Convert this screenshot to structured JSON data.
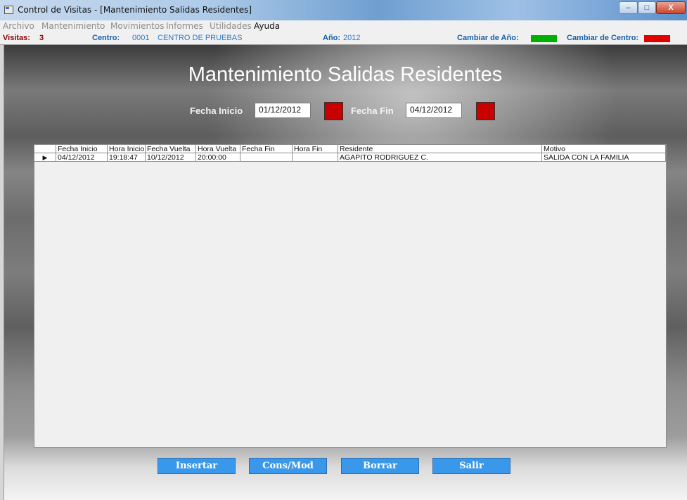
{
  "window": {
    "title": "Control de Visitas - [Mantenimiento Salidas Residentes]",
    "buttons": {
      "minimize": "–",
      "maximize": "□",
      "close": "X"
    }
  },
  "menu": [
    "Archivo",
    "Mantenimiento",
    "Movimientos",
    "Informes",
    "Utilidades",
    "Ayuda"
  ],
  "status": {
    "visitas_label": "Visitas:",
    "visitas_value": "3",
    "centro_label": "Centro:",
    "centro_code": "0001",
    "centro_name": "CENTRO DE PRUEBAS",
    "anio_label": "Año:",
    "anio_value": "2012",
    "cambiar_anio_label": "Cambiar de Año:",
    "cambiar_anio_color": "#00b000",
    "cambiar_centro_label": "Cambiar de Centro:",
    "cambiar_centro_color": "#e00000"
  },
  "page": {
    "heading": "Mantenimiento Salidas Residentes",
    "fecha_inicio_label": "Fecha Inicio",
    "fecha_inicio_value": "01/12/2012",
    "fecha_fin_label": "Fecha Fin",
    "fecha_fin_value": "04/12/2012",
    "calendar_color": "#c80000"
  },
  "grid": {
    "columns": [
      "Fecha Inicio",
      "Hora Inicio",
      "Fecha Vuelta",
      "Hora Vuelta",
      "Fecha Fin",
      "Hora Fin",
      "Residente",
      "Motivo"
    ],
    "rows": [
      {
        "selector": "▶",
        "cells": [
          "04/12/2012",
          "19:18:47",
          "10/12/2012",
          "20:00:00",
          "",
          "",
          "AGAPITO RODRIGUEZ C.",
          "SALIDA CON LA FAMILIA"
        ]
      }
    ]
  },
  "actions": {
    "insertar": "Insertar",
    "cons_mod": "Cons/Mod",
    "borrar": "Borrar",
    "salir": "Salir",
    "button_color": "#3a98ea"
  }
}
